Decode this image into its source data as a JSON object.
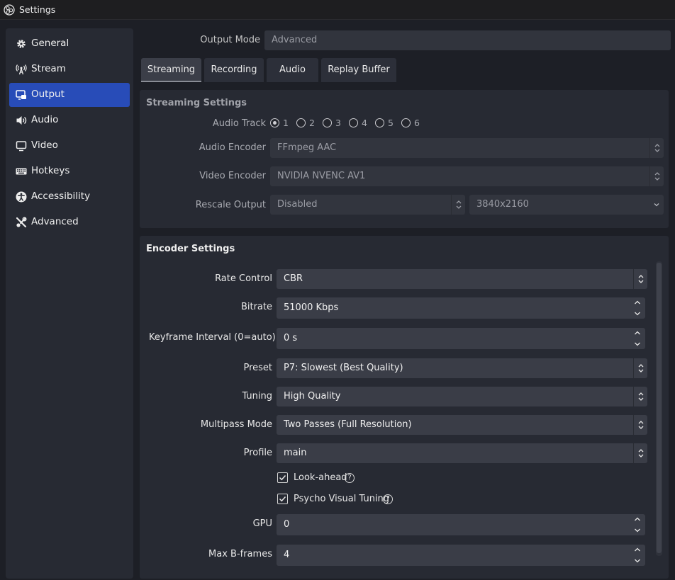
{
  "window": {
    "title": "Settings"
  },
  "sidebar": {
    "items": [
      {
        "label": "General",
        "icon": "gear-icon",
        "active": false
      },
      {
        "label": "Stream",
        "icon": "antenna-icon",
        "active": false
      },
      {
        "label": "Output",
        "icon": "output-icon",
        "active": true
      },
      {
        "label": "Audio",
        "icon": "speaker-icon",
        "active": false
      },
      {
        "label": "Video",
        "icon": "monitor-icon",
        "active": false
      },
      {
        "label": "Hotkeys",
        "icon": "keyboard-icon",
        "active": false
      },
      {
        "label": "Accessibility",
        "icon": "accessibility-icon",
        "active": false
      },
      {
        "label": "Advanced",
        "icon": "wrench-icon",
        "active": false
      }
    ]
  },
  "output_mode": {
    "label": "Output Mode",
    "value": "Advanced"
  },
  "tabs": [
    {
      "label": "Streaming",
      "active": true
    },
    {
      "label": "Recording",
      "active": false
    },
    {
      "label": "Audio",
      "active": false
    },
    {
      "label": "Replay Buffer",
      "active": false
    }
  ],
  "streaming_settings": {
    "title": "Streaming Settings",
    "audio_track_label": "Audio Track",
    "audio_tracks": [
      "1",
      "2",
      "3",
      "4",
      "5",
      "6"
    ],
    "selected_track": "1",
    "audio_encoder_label": "Audio Encoder",
    "audio_encoder": "FFmpeg AAC",
    "video_encoder_label": "Video Encoder",
    "video_encoder": "NVIDIA NVENC AV1",
    "rescale_label": "Rescale Output",
    "rescale_value": "Disabled",
    "rescale_resolution": "3840x2160"
  },
  "encoder_settings": {
    "title": "Encoder Settings",
    "rate_control_label": "Rate Control",
    "rate_control": "CBR",
    "bitrate_label": "Bitrate",
    "bitrate": "51000 Kbps",
    "keyframe_label": "Keyframe Interval (0=auto)",
    "keyframe": "0 s",
    "preset_label": "Preset",
    "preset": "P7: Slowest (Best Quality)",
    "tuning_label": "Tuning",
    "tuning": "High Quality",
    "multipass_label": "Multipass Mode",
    "multipass": "Two Passes (Full Resolution)",
    "profile_label": "Profile",
    "profile": "main",
    "lookahead_label": "Look-ahead",
    "lookahead_checked": true,
    "psycho_label": "Psycho Visual Tuning",
    "psycho_checked": true,
    "help_glyph": "?",
    "gpu_label": "GPU",
    "gpu": "0",
    "bframes_label": "Max B-frames",
    "bframes": "4"
  },
  "colors": {
    "accent": "#284cb8",
    "background": "#1d1f26",
    "panel": "#272a33",
    "field": "#3a3d47"
  }
}
